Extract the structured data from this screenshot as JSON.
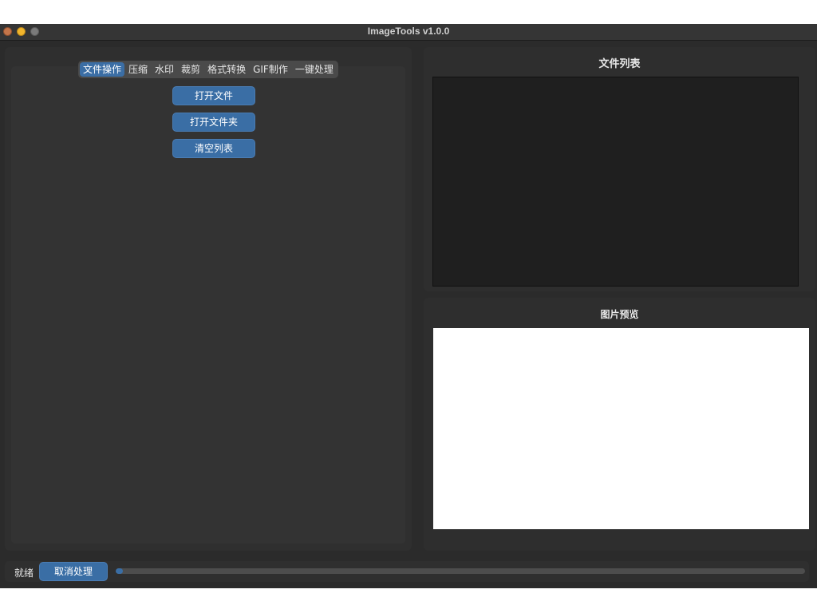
{
  "window": {
    "title": "ImageTools v1.0.0"
  },
  "tabs": [
    {
      "label": "文件操作",
      "active": true
    },
    {
      "label": "压缩"
    },
    {
      "label": "水印"
    },
    {
      "label": "裁剪"
    },
    {
      "label": "格式转换"
    },
    {
      "label": "GIF制作"
    },
    {
      "label": "一键处理"
    }
  ],
  "file_ops": {
    "open_file": "打开文件",
    "open_folder": "打开文件夹",
    "clear_list": "清空列表"
  },
  "file_list": {
    "heading": "文件列表"
  },
  "preview": {
    "heading": "图片预览"
  },
  "status": {
    "text": "就绪",
    "cancel_label": "取消处理",
    "progress": 0.01
  },
  "colors": {
    "accent": "#3a6ea5",
    "background": "#2b2b2b"
  }
}
